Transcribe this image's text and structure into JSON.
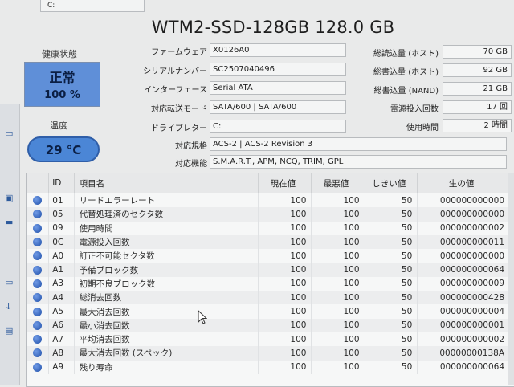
{
  "top_tab": "C:",
  "title": "WTM2-SSD-128GB 128.0 GB",
  "health": {
    "label": "健康状態",
    "status": "正常",
    "percent": "100 %"
  },
  "temperature": {
    "label": "温度",
    "value": "29 °C"
  },
  "info": [
    {
      "label": "ファームウェア",
      "value": "X0126A0"
    },
    {
      "label": "シリアルナンバー",
      "value": "SC2507040496"
    },
    {
      "label": "インターフェース",
      "value": "Serial ATA"
    },
    {
      "label": "対応転送モード",
      "value": "SATA/600 | SATA/600"
    },
    {
      "label": "ドライブレター",
      "value": "C:"
    }
  ],
  "standard": {
    "label": "対応規格",
    "value": "ACS-2 | ACS-2 Revision 3"
  },
  "features": {
    "label": "対応機能",
    "value": "S.M.A.R.T., APM, NCQ, TRIM, GPL"
  },
  "stats": [
    {
      "label": "総読込量 (ホスト)",
      "value": "70 GB"
    },
    {
      "label": "総書込量 (ホスト)",
      "value": "92 GB"
    },
    {
      "label": "総書込量 (NAND)",
      "value": "21 GB"
    },
    {
      "label": "電源投入回数",
      "value": "17 回"
    },
    {
      "label": "使用時間",
      "value": "2 時間"
    }
  ],
  "table": {
    "headers": {
      "id": "ID",
      "name": "項目名",
      "current": "現在値",
      "worst": "最悪値",
      "threshold": "しきい値",
      "raw": "生の値"
    },
    "rows": [
      {
        "id": "01",
        "name": "リードエラーレート",
        "current": "100",
        "worst": "100",
        "threshold": "50",
        "raw": "000000000000"
      },
      {
        "id": "05",
        "name": "代替処理済のセクタ数",
        "current": "100",
        "worst": "100",
        "threshold": "50",
        "raw": "000000000000"
      },
      {
        "id": "09",
        "name": "使用時間",
        "current": "100",
        "worst": "100",
        "threshold": "50",
        "raw": "000000000002"
      },
      {
        "id": "0C",
        "name": "電源投入回数",
        "current": "100",
        "worst": "100",
        "threshold": "50",
        "raw": "000000000011"
      },
      {
        "id": "A0",
        "name": "訂正不可能セクタ数",
        "current": "100",
        "worst": "100",
        "threshold": "50",
        "raw": "000000000000"
      },
      {
        "id": "A1",
        "name": "予備ブロック数",
        "current": "100",
        "worst": "100",
        "threshold": "50",
        "raw": "000000000064"
      },
      {
        "id": "A3",
        "name": "初期不良ブロック数",
        "current": "100",
        "worst": "100",
        "threshold": "50",
        "raw": "000000000009"
      },
      {
        "id": "A4",
        "name": "総消去回数",
        "current": "100",
        "worst": "100",
        "threshold": "50",
        "raw": "000000000428"
      },
      {
        "id": "A5",
        "name": "最大消去回数",
        "current": "100",
        "worst": "100",
        "threshold": "50",
        "raw": "000000000004"
      },
      {
        "id": "A6",
        "name": "最小消去回数",
        "current": "100",
        "worst": "100",
        "threshold": "50",
        "raw": "000000000001"
      },
      {
        "id": "A7",
        "name": "平均消去回数",
        "current": "100",
        "worst": "100",
        "threshold": "50",
        "raw": "000000000002"
      },
      {
        "id": "A8",
        "name": "最大消去回数 (スペック)",
        "current": "100",
        "worst": "100",
        "threshold": "50",
        "raw": "00000000138A"
      },
      {
        "id": "A9",
        "name": "残り寿命",
        "current": "100",
        "worst": "100",
        "threshold": "50",
        "raw": "000000000064"
      }
    ]
  },
  "colors": {
    "health_bg": "#5f8fd8",
    "temp_bg": "#4b86d6",
    "status_dot": "#2e63c6"
  }
}
